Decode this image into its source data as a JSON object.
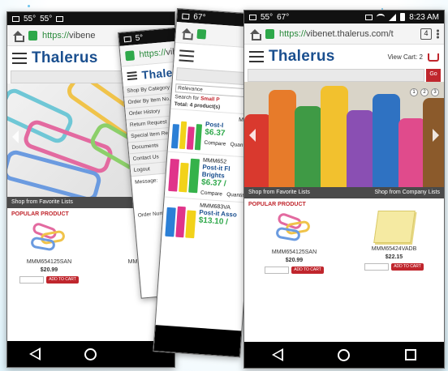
{
  "status": {
    "time": "8:23 AM",
    "temp_a": "55°",
    "temp_b": "55°",
    "temp_c": "67°",
    "notif_c": "5°"
  },
  "browser": {
    "url_secure": "https://",
    "url_host_full": "vibenet.thalerus.com/t",
    "url_host_short": "vibene",
    "tab_count": "4"
  },
  "site": {
    "brand": "Thalerus",
    "view_cart": "View Cart: 2",
    "go_label": "Go",
    "shop_favorites": "Shop from Favorite Lists",
    "shop_company": "Shop from Company Lists",
    "popular_title": "POPULAR PRODUCT",
    "add_to_cart": "ADD TO CART"
  },
  "carousel": {
    "pages": [
      "1",
      "2",
      "3"
    ]
  },
  "products_main": [
    {
      "sku": "MMM654125SAN",
      "price": "$20.99"
    },
    {
      "sku": "MMM65424VADB",
      "price": "$22.15"
    }
  ],
  "products_left": [
    {
      "sku": "MMM654125SAN",
      "price": "$20.99"
    },
    {
      "sku": "MM",
      "price": ""
    }
  ],
  "side_menu": {
    "items": [
      "Shop By Category",
      "Order By Item No.",
      "Order History",
      "Return Request",
      "Special Item Request",
      "Documents",
      "Contact Us",
      "Logout"
    ],
    "message_label": "Message:",
    "order_number_label": "Order Number"
  },
  "listing": {
    "sort": "Relevance",
    "search_prefix": "Search for",
    "search_term": "Small P",
    "total": "Total: 4 product(s)",
    "items": [
      {
        "sku": "MMM",
        "name": "Post-I",
        "price": "$6.37",
        "compare": "Compare",
        "qty": "Quantity"
      },
      {
        "sku": "MMM652",
        "name": "Post-it Fl Brights",
        "price": "$6.37 /",
        "compare": "Compare",
        "qty": "Quantity"
      },
      {
        "sku": "MMM683VA",
        "name": "Post-it Asso",
        "price": "$13.10 /",
        "compare": "",
        "qty": ""
      }
    ]
  }
}
